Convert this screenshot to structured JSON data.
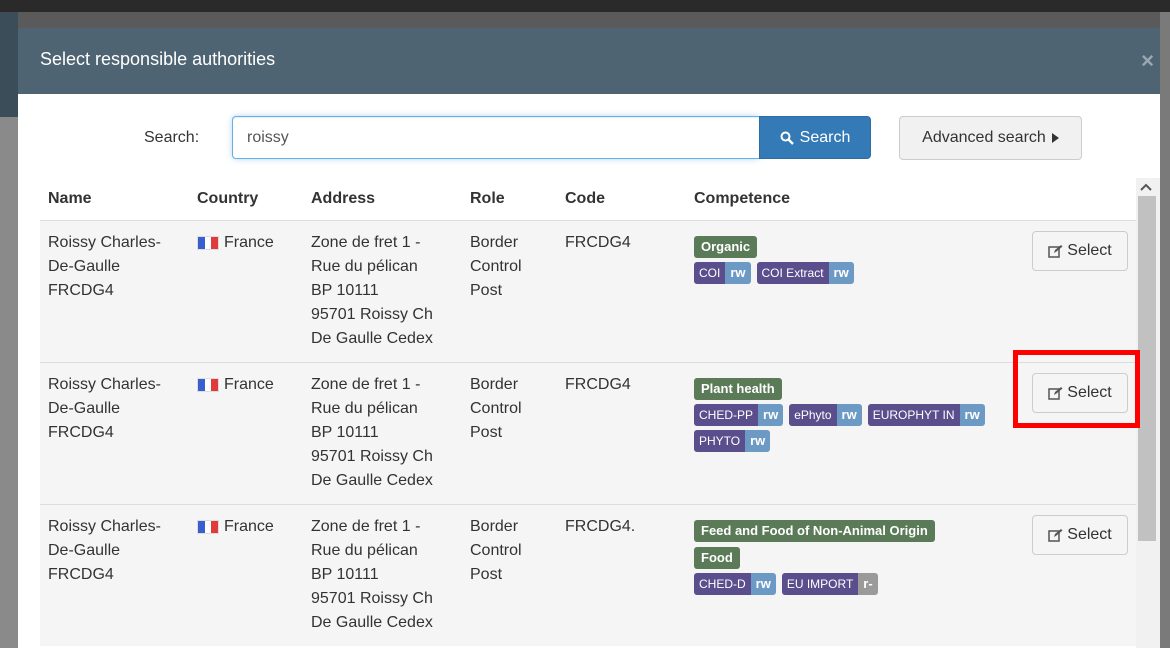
{
  "modal": {
    "title": "Select responsible authorities",
    "close_glyph": "×"
  },
  "search": {
    "label": "Search:",
    "value": "roissy",
    "button_label": "Search",
    "advanced_label": "Advanced search"
  },
  "table": {
    "headers": [
      "Name",
      "Country",
      "Address",
      "Role",
      "Code",
      "Competence"
    ],
    "select_label": "Select",
    "rows": [
      {
        "name": [
          "Roissy Charles-",
          "De-Gaulle",
          "FRCDG4"
        ],
        "country": "France",
        "address": [
          "Zone de fret 1 -",
          "Rue du pélican",
          "BP 10111",
          "95701 Roissy Ch",
          "De Gaulle Cedex"
        ],
        "role": [
          "Border",
          "Control",
          "Post"
        ],
        "code": "FRCDG4",
        "competences": [
          "Organic"
        ],
        "chips": [
          {
            "name": "COI",
            "rights": "rw"
          },
          {
            "name": "COI Extract",
            "rights": "rw"
          }
        ]
      },
      {
        "name": [
          "Roissy Charles-",
          "De-Gaulle",
          "FRCDG4"
        ],
        "country": "France",
        "address": [
          "Zone de fret 1 -",
          "Rue du pélican",
          "BP 10111",
          "95701 Roissy Ch",
          "De Gaulle Cedex"
        ],
        "role": [
          "Border",
          "Control",
          "Post"
        ],
        "code": "FRCDG4",
        "competences": [
          "Plant health"
        ],
        "chips": [
          {
            "name": "CHED-PP",
            "rights": "rw"
          },
          {
            "name": "ePhyto",
            "rights": "rw"
          },
          {
            "name": "EUROPHYT IN",
            "rights": "rw"
          },
          {
            "name": "PHYTO",
            "rights": "rw"
          }
        ]
      },
      {
        "name": [
          "Roissy Charles-",
          "De-Gaulle",
          "FRCDG4"
        ],
        "country": "France",
        "address": [
          "Zone de fret 1 -",
          "Rue du pélican",
          "BP 10111",
          "95701 Roissy Ch",
          "De Gaulle Cedex"
        ],
        "role": [
          "Border",
          "Control",
          "Post"
        ],
        "code": "FRCDG4.",
        "competences": [
          "Feed and Food of Non-Animal Origin",
          "Food"
        ],
        "chips": [
          {
            "name": "CHED-D",
            "rights": "rw"
          },
          {
            "name": "EU IMPORT",
            "rights": "r-"
          }
        ]
      }
    ]
  },
  "icons": {
    "search": "magnifier-icon",
    "advanced": "caret-right-icon",
    "select": "edit-icon",
    "scroll_up": "chevron-up-icon"
  },
  "colors": {
    "header_bg": "#4f6473",
    "primary": "#337ab7",
    "competence_bg": "#5b7b58",
    "chip_name": "#5a4f8c",
    "chip_rights": "#6c9ac5",
    "chip_readonly": "#9a9a9a",
    "highlight": "#ff0000"
  }
}
